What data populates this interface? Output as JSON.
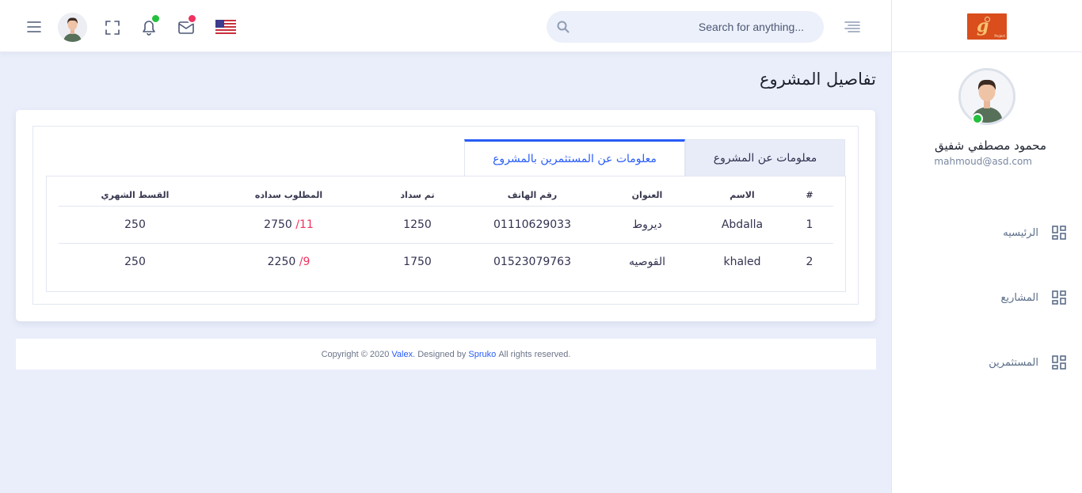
{
  "header": {
    "search_placeholder": "Search for anything...",
    "icons": [
      "menu-icon",
      "avatar",
      "fullscreen-icon",
      "bell-icon",
      "mail-icon",
      "us-flag-icon",
      "search-icon",
      "align-right-icon"
    ],
    "notification_badge_color": "#22c03c",
    "mail_badge_color": "#ee335e"
  },
  "sidebar": {
    "profile": {
      "name": "محمود مصطفي شفيق",
      "email": "mahmoud@asd.com"
    },
    "items": [
      {
        "label": "الرئيسيه",
        "icon": "dashboard-grid-icon"
      },
      {
        "label": "المشاريع",
        "icon": "dashboard-grid-icon"
      },
      {
        "label": "المستثمرين",
        "icon": "dashboard-grid-icon"
      }
    ]
  },
  "page": {
    "title": "تفاصيل المشروع"
  },
  "tabs": [
    {
      "label": "معلومات عن المشروع",
      "active": false
    },
    {
      "label": "معلومات عن المستثمرين بالمشروع",
      "active": true
    }
  ],
  "table": {
    "columns": [
      "#",
      "الاسم",
      "العنوان",
      "رقم الهاتف",
      "تم سداد",
      "المطلوب سداده",
      "القسط الشهري"
    ],
    "rows": [
      {
        "num": "1",
        "name": "Abdalla",
        "address": "ديروط",
        "phone": "01110629033",
        "paid": "1250",
        "required_total": "2750",
        "required_sep": "/",
        "required_count": "11",
        "monthly": "250"
      },
      {
        "num": "2",
        "name": "khaled",
        "address": "القوصيه",
        "phone": "01523079763",
        "paid": "1750",
        "required_total": "2250",
        "required_sep": "/",
        "required_count": "9",
        "monthly": "250"
      }
    ]
  },
  "footer": {
    "prefix": "Copyright © 2020 ",
    "brand": "Valex",
    "mid": ". Designed by ",
    "designer": "Spruko",
    "suffix": " All rights reserved."
  },
  "colors": {
    "accent": "#285cf7",
    "danger": "#ee335e",
    "online": "#22c03c",
    "background": "#eaeefb"
  }
}
